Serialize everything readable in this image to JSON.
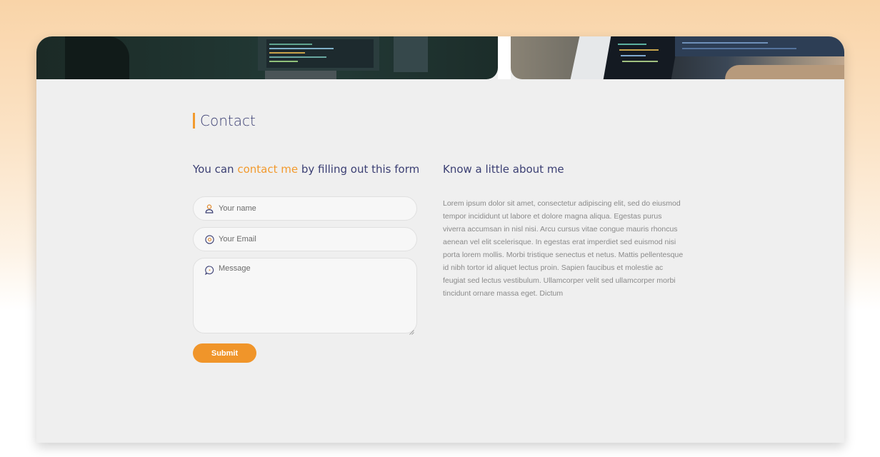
{
  "contact": {
    "title": "Contact",
    "form_heading_prefix": "You can ",
    "form_heading_accent": "contact me",
    "form_heading_suffix": " by filling out this form",
    "name_placeholder": "Your name",
    "email_placeholder": "Your Email",
    "message_placeholder": "Message",
    "submit_label": "Submit"
  },
  "about": {
    "heading": "Know a little about me",
    "body": "Lorem ipsum dolor sit amet, consectetur adipiscing elit, sed do eiusmod tempor incididunt ut labore et dolore magna aliqua. Egestas purus viverra accumsan in nisl nisi. Arcu cursus vitae congue mauris rhoncus aenean vel elit scelerisque. In egestas erat imperdiet sed euismod nisi porta lorem mollis. Morbi tristique senectus et netus. Mattis pellentesque id nibh tortor id aliquet lectus proin. Sapien faucibus et molestie ac feugiat sed lectus vestibulum. Ullamcorper velit sed ullamcorper morbi tincidunt ornare massa eget. Dictum"
  },
  "colors": {
    "accent": "#f29a2e",
    "heading": "#3b3f73",
    "panel": "#efefef"
  },
  "icons": {
    "name": "user-icon",
    "email": "at-icon",
    "message": "chat-bubble-icon"
  }
}
